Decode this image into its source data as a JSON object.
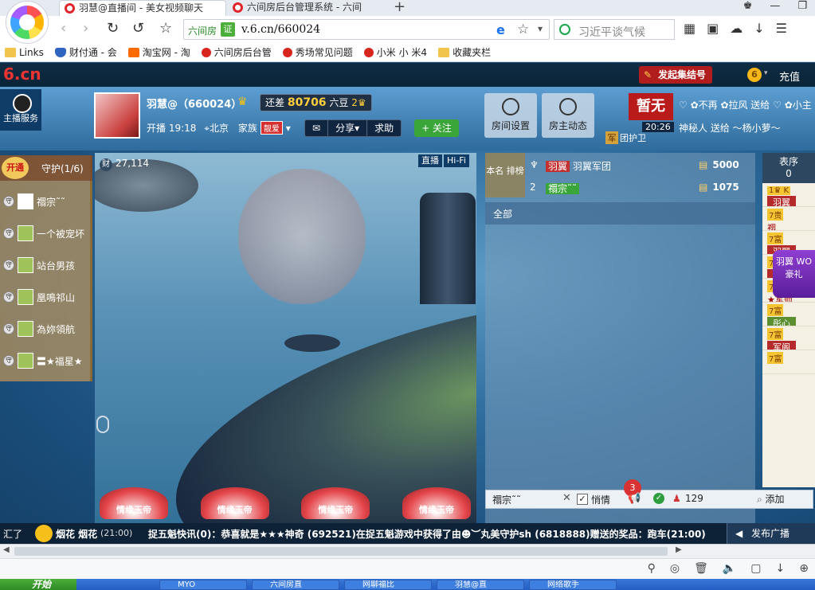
{
  "browser": {
    "tabs": [
      {
        "label": "羽慧@直播间 - 美女视频聊天"
      },
      {
        "label": "六间房后台管理系统 - 六间"
      }
    ],
    "new_tab": "+",
    "address": {
      "site_label": "六间房",
      "badge": "证",
      "url": "v.6.cn/660024"
    },
    "search_placeholder": "习近平谈气候",
    "bookmarks": [
      "Links",
      "财付通 - 会",
      "淘宝网 - 淘",
      "六间房后台管",
      "秀场常见问题",
      "小米 小 米4",
      "收藏夹栏"
    ]
  },
  "site": {
    "logo": "6.cn",
    "collect_button": "发起集结号",
    "coin_icon": "6",
    "recharge": "充值"
  },
  "room": {
    "qq_service": "主播服务",
    "anchor": {
      "name": "羽慧@（660024）",
      "gap_label": "还差",
      "gap_value": "80706",
      "gap_unit": "六豆",
      "level": "2",
      "live_time": "开播 19:18",
      "location": "北京",
      "family_label": "家族",
      "family_tag": "靓爱"
    },
    "actions": {
      "message": "✉",
      "share": "分享▾",
      "ask": "求助",
      "follow": "+ 关注"
    },
    "room_settings": "房间设置",
    "host_dynamic": "房主动态",
    "temp_none": "暂无",
    "feed": {
      "line1": "♡ ✿不再 ✿拉风 送给 ♡ ✿小主",
      "time": "20:26",
      "line2": "神秘人 送给 ～杨小萝～"
    },
    "guard_team": "团护卫",
    "guard": {
      "open": "开通",
      "title": "守护(1/6)",
      "items": [
        "禤宗˜˜",
        "一个被宠坏",
        "站台男孩",
        "凰鳴祁山",
        "為妳領航",
        "〓★福星★"
      ]
    },
    "video": {
      "wealth": "27,114",
      "live_badge": "直播",
      "hifi_badge": "Hi-Fi",
      "gifts": [
        "情缘玉帝",
        "情缘玉帝",
        "情缘玉帝",
        "情缘玉帝"
      ]
    },
    "ranking": {
      "tab": "本名 排榜",
      "rows": [
        {
          "rank": "",
          "name": "羽翼",
          "team": "羽翼军团",
          "score": "5000"
        },
        {
          "rank": "2",
          "name": "禤宗˜˜",
          "team": "",
          "score": "1075"
        }
      ],
      "all_tab": "全部"
    },
    "chat": {
      "target": "禤宗˜˜",
      "close": "✕",
      "quiet_label": "悄情",
      "horn_count": "3",
      "viewers": "129",
      "add": "添加"
    },
    "seats": {
      "header_top": "表序",
      "header_num": "0",
      "items": [
        {
          "level": "1♛ K",
          "name": "羽翼"
        },
        {
          "level": "7贵",
          "name": "禤"
        },
        {
          "level": "7富",
          "name": "羽翼"
        },
        {
          "level": "7富",
          "name": "小C"
        },
        {
          "level": "7富",
          "name": "★军师"
        },
        {
          "level": "7富",
          "name": "彤心"
        },
        {
          "level": "7富",
          "name": "军阁"
        },
        {
          "level": "7富",
          "name": ""
        }
      ]
    },
    "promo": "羽翼 WO 豪礼"
  },
  "announce": {
    "left": "汇了",
    "gift": "烟花 烟花",
    "time1": "(21:00)",
    "msg": "捉五魁快讯(0)：恭喜就是★★★神奇 (692521)在捉五魁游戏中获得了由☻︶丸美守护sh (6818888)赠送的奖品：跑车(21:00)",
    "broadcast": "发布广播"
  },
  "taskbar": {
    "start": "开始",
    "tasks": [
      "MYO",
      "六间房直",
      "网聊福比",
      "羽慧@直",
      "网络歌手"
    ]
  }
}
